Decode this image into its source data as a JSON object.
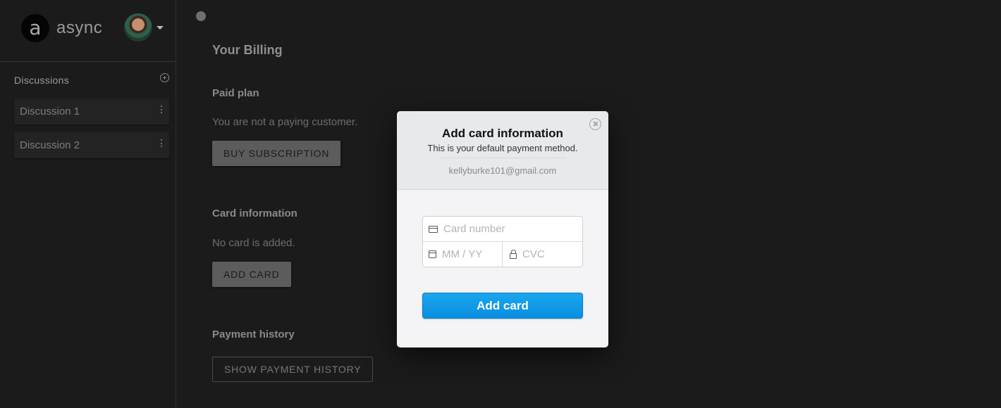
{
  "sidebar": {
    "brand": {
      "logo_letter": "a",
      "name": "async"
    },
    "discussions": {
      "title": "Discussions",
      "items": [
        {
          "label": "Discussion 1"
        },
        {
          "label": "Discussion 2"
        }
      ]
    }
  },
  "main": {
    "page_title": "Your Billing",
    "paid_plan": {
      "title": "Paid plan",
      "text": "You are not a paying customer.",
      "button": "BUY SUBSCRIPTION"
    },
    "card_info": {
      "title": "Card information",
      "text": "No card is added.",
      "button": "ADD CARD"
    },
    "payment_history": {
      "title": "Payment history",
      "button": "SHOW PAYMENT HISTORY"
    }
  },
  "modal": {
    "title": "Add card information",
    "subtitle": "This is your default payment method.",
    "email": "kellyburke101@gmail.com",
    "fields": {
      "card_number_placeholder": "Card number",
      "expiry_placeholder": "MM / YY",
      "cvc_placeholder": "CVC"
    },
    "submit_label": "Add card",
    "accent_color": "#0a8ee0"
  }
}
